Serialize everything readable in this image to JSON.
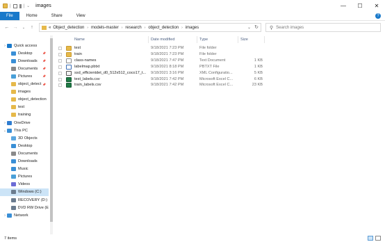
{
  "window": {
    "title": "images",
    "minimize": "—",
    "maximize": "☐",
    "close": "✕"
  },
  "ribbon": {
    "tabs": [
      "File",
      "Home",
      "Share",
      "View"
    ],
    "help": "?"
  },
  "address": {
    "prefix": "«",
    "segments": [
      "Object_detection",
      "models-master",
      "research",
      "object_detection",
      "images"
    ],
    "search_placeholder": "Search images"
  },
  "columns": {
    "name": "Name",
    "date": "Date modified",
    "type": "Type",
    "size": "Size"
  },
  "files": [
    {
      "name": "test",
      "date": "9/18/2021 7:23 PM",
      "type": "File folder",
      "size": "",
      "icon": "folder-icon"
    },
    {
      "name": "train",
      "date": "9/18/2021 7:23 PM",
      "type": "File folder",
      "size": "",
      "icon": "folder-icon"
    },
    {
      "name": "class-names",
      "date": "9/18/2021 7:47 PM",
      "type": "Text Document",
      "size": "1 KB",
      "icon": "text-file-icon"
    },
    {
      "name": "labelmap.pbtxt",
      "date": "9/18/2021 8:18 PM",
      "type": "PBTXT File",
      "size": "1 KB",
      "icon": "pbtxt-file-icon"
    },
    {
      "name": "ssd_efficientdet_d0_512x512_coco17_t...",
      "date": "9/18/2021 3:16 PM",
      "type": "XML Configuratio...",
      "size": "5 KB",
      "icon": "config-file-icon"
    },
    {
      "name": "test_labels.csv",
      "date": "9/18/2021 7:42 PM",
      "type": "Microsoft Excel C...",
      "size": "6 KB",
      "icon": "excel-csv-icon"
    },
    {
      "name": "train_labels.csv",
      "date": "9/18/2021 7:42 PM",
      "type": "Microsoft Excel C...",
      "size": "23 KB",
      "icon": "excel-csv-icon"
    }
  ],
  "nav": [
    {
      "label": "Quick access",
      "icon": "star-icon",
      "color": "#1979ca",
      "pinned": false,
      "level": 0,
      "expand": "›"
    },
    {
      "label": "Desktop",
      "icon": "desktop-icon",
      "color": "#3a8fd6",
      "pinned": true,
      "level": 1
    },
    {
      "label": "Downloads",
      "icon": "downloads-icon",
      "color": "#3a8fd6",
      "pinned": true,
      "level": 1
    },
    {
      "label": "Documents",
      "icon": "documents-icon",
      "color": "#8a8a8a",
      "pinned": true,
      "level": 1
    },
    {
      "label": "Pictures",
      "icon": "pictures-icon",
      "color": "#4aa0d8",
      "pinned": true,
      "level": 1
    },
    {
      "label": "object_detect",
      "icon": "folder-icon",
      "color": "#e6b94a",
      "pinned": true,
      "level": 1
    },
    {
      "label": "images",
      "icon": "folder-icon",
      "color": "#e6b94a",
      "pinned": false,
      "level": 1
    },
    {
      "label": "object_detection",
      "icon": "folder-icon",
      "color": "#e6b94a",
      "pinned": false,
      "level": 1
    },
    {
      "label": "test",
      "icon": "folder-icon",
      "color": "#e6b94a",
      "pinned": false,
      "level": 1
    },
    {
      "label": "training",
      "icon": "folder-icon",
      "color": "#e6b94a",
      "pinned": false,
      "level": 1
    },
    {
      "label": "OneDrive",
      "icon": "onedrive-icon",
      "color": "#2f7dd1",
      "pinned": false,
      "level": 0,
      "expand": "›"
    },
    {
      "label": "This PC",
      "icon": "computer-icon",
      "color": "#3a8fd6",
      "pinned": false,
      "level": 0,
      "expand": "⌄"
    },
    {
      "label": "3D Objects",
      "icon": "3d-objects-icon",
      "color": "#5aa7e0",
      "pinned": false,
      "level": 1
    },
    {
      "label": "Desktop",
      "icon": "desktop-icon",
      "color": "#3a8fd6",
      "pinned": false,
      "level": 1
    },
    {
      "label": "Documents",
      "icon": "documents-icon",
      "color": "#8a8a8a",
      "pinned": false,
      "level": 1
    },
    {
      "label": "Downloads",
      "icon": "downloads-icon",
      "color": "#3a8fd6",
      "pinned": false,
      "level": 1
    },
    {
      "label": "Music",
      "icon": "music-icon",
      "color": "#3a8fd6",
      "pinned": false,
      "level": 1
    },
    {
      "label": "Pictures",
      "icon": "pictures-icon",
      "color": "#4aa0d8",
      "pinned": false,
      "level": 1
    },
    {
      "label": "Videos",
      "icon": "videos-icon",
      "color": "#6b6bd6",
      "pinned": false,
      "level": 1
    },
    {
      "label": "Windows (C:)",
      "icon": "drive-icon",
      "color": "#6b7c8f",
      "pinned": false,
      "level": 1,
      "selected": true
    },
    {
      "label": "RECOVERY (D:)",
      "icon": "drive-icon",
      "color": "#6b7c8f",
      "pinned": false,
      "level": 1
    },
    {
      "label": "DVD RW Drive (E",
      "icon": "dvd-drive-icon",
      "color": "#6b7c8f",
      "pinned": false,
      "level": 1
    },
    {
      "label": "Network",
      "icon": "network-icon",
      "color": "#3a8fd6",
      "pinned": false,
      "level": 0,
      "expand": "›"
    }
  ],
  "status": {
    "item_count": "7 items"
  }
}
